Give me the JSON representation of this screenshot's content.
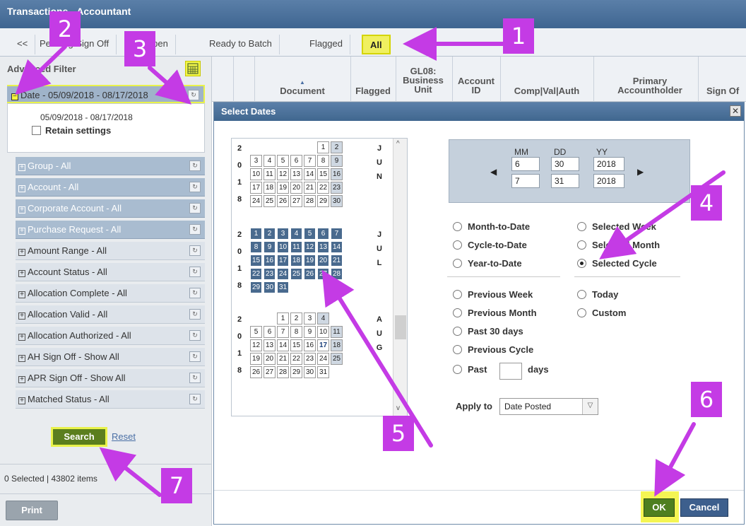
{
  "app": {
    "title": "Transactions - Accountant"
  },
  "tabs": [
    {
      "label": "<<"
    },
    {
      "label": "Pending Sign Off"
    },
    {
      "label": "Open"
    },
    {
      "label": "Ready to Batch"
    },
    {
      "label": "Flagged"
    },
    {
      "label": "All",
      "active": true
    }
  ],
  "left": {
    "advanced_filter": "Advanced Filter",
    "date_filter": {
      "label": "Date - 05/09/2018 - 08/17/2018",
      "range": "05/09/2018 - 08/17/2018",
      "retain": "Retain settings"
    },
    "filters": [
      {
        "label": "Group - All"
      },
      {
        "label": "Account - All"
      },
      {
        "label": "Corporate Account - All"
      },
      {
        "label": "Purchase Request - All"
      },
      {
        "label": "Amount Range - All"
      },
      {
        "label": "Account Status - All"
      },
      {
        "label": "Allocation Complete - All"
      },
      {
        "label": "Allocation Valid - All"
      },
      {
        "label": "Allocation Authorized - All"
      },
      {
        "label": "AH Sign Off - Show All"
      },
      {
        "label": "APR Sign Off - Show All"
      },
      {
        "label": "Matched Status - All"
      }
    ],
    "search": "Search",
    "reset": "Reset",
    "status": "0 Selected | 43802 items",
    "print": "Print"
  },
  "grid_headers": [
    {
      "label": "Document"
    },
    {
      "label": "Flagged"
    },
    {
      "label": "GL08: Business Unit"
    },
    {
      "label": "Account ID"
    },
    {
      "label": "Comp|Val|Auth"
    },
    {
      "label": "Primary Accountholder"
    },
    {
      "label": "Sign Of"
    }
  ],
  "dialog": {
    "title": "Select Dates",
    "close": "✕",
    "year": [
      "2",
      "0",
      "1",
      "8"
    ],
    "months": {
      "june": [
        "J",
        "U",
        "N"
      ],
      "july": [
        "J",
        "U",
        "L"
      ],
      "aug": [
        "A",
        "U",
        "G"
      ]
    },
    "headers": {
      "mm": "MM",
      "dd": "DD",
      "yy": "YY"
    },
    "from": {
      "mm": "6",
      "dd": "30",
      "yy": "2018"
    },
    "to": {
      "mm": "7",
      "dd": "31",
      "yy": "2018"
    },
    "radios_left": [
      "Month-to-Date",
      "Cycle-to-Date",
      "Year-to-Date",
      "Previous Week",
      "Previous Month",
      "Past 30 days",
      "Previous Cycle",
      "Past"
    ],
    "radios_right": [
      "Selected Week",
      "Selected Month",
      "Selected Cycle",
      "Today",
      "Custom"
    ],
    "selected": "Selected Cycle",
    "past_days_suffix": "days",
    "apply_to_label": "Apply to",
    "apply_to_value": "Date Posted",
    "ok": "OK",
    "cancel": "Cancel"
  },
  "badges": [
    "1",
    "2",
    "3",
    "4",
    "5",
    "6",
    "7"
  ],
  "colors": {
    "accent": "#c43be5",
    "highlight": "#f4f553",
    "ok": "#4e7f1f",
    "cancel": "#3d5f8d"
  }
}
